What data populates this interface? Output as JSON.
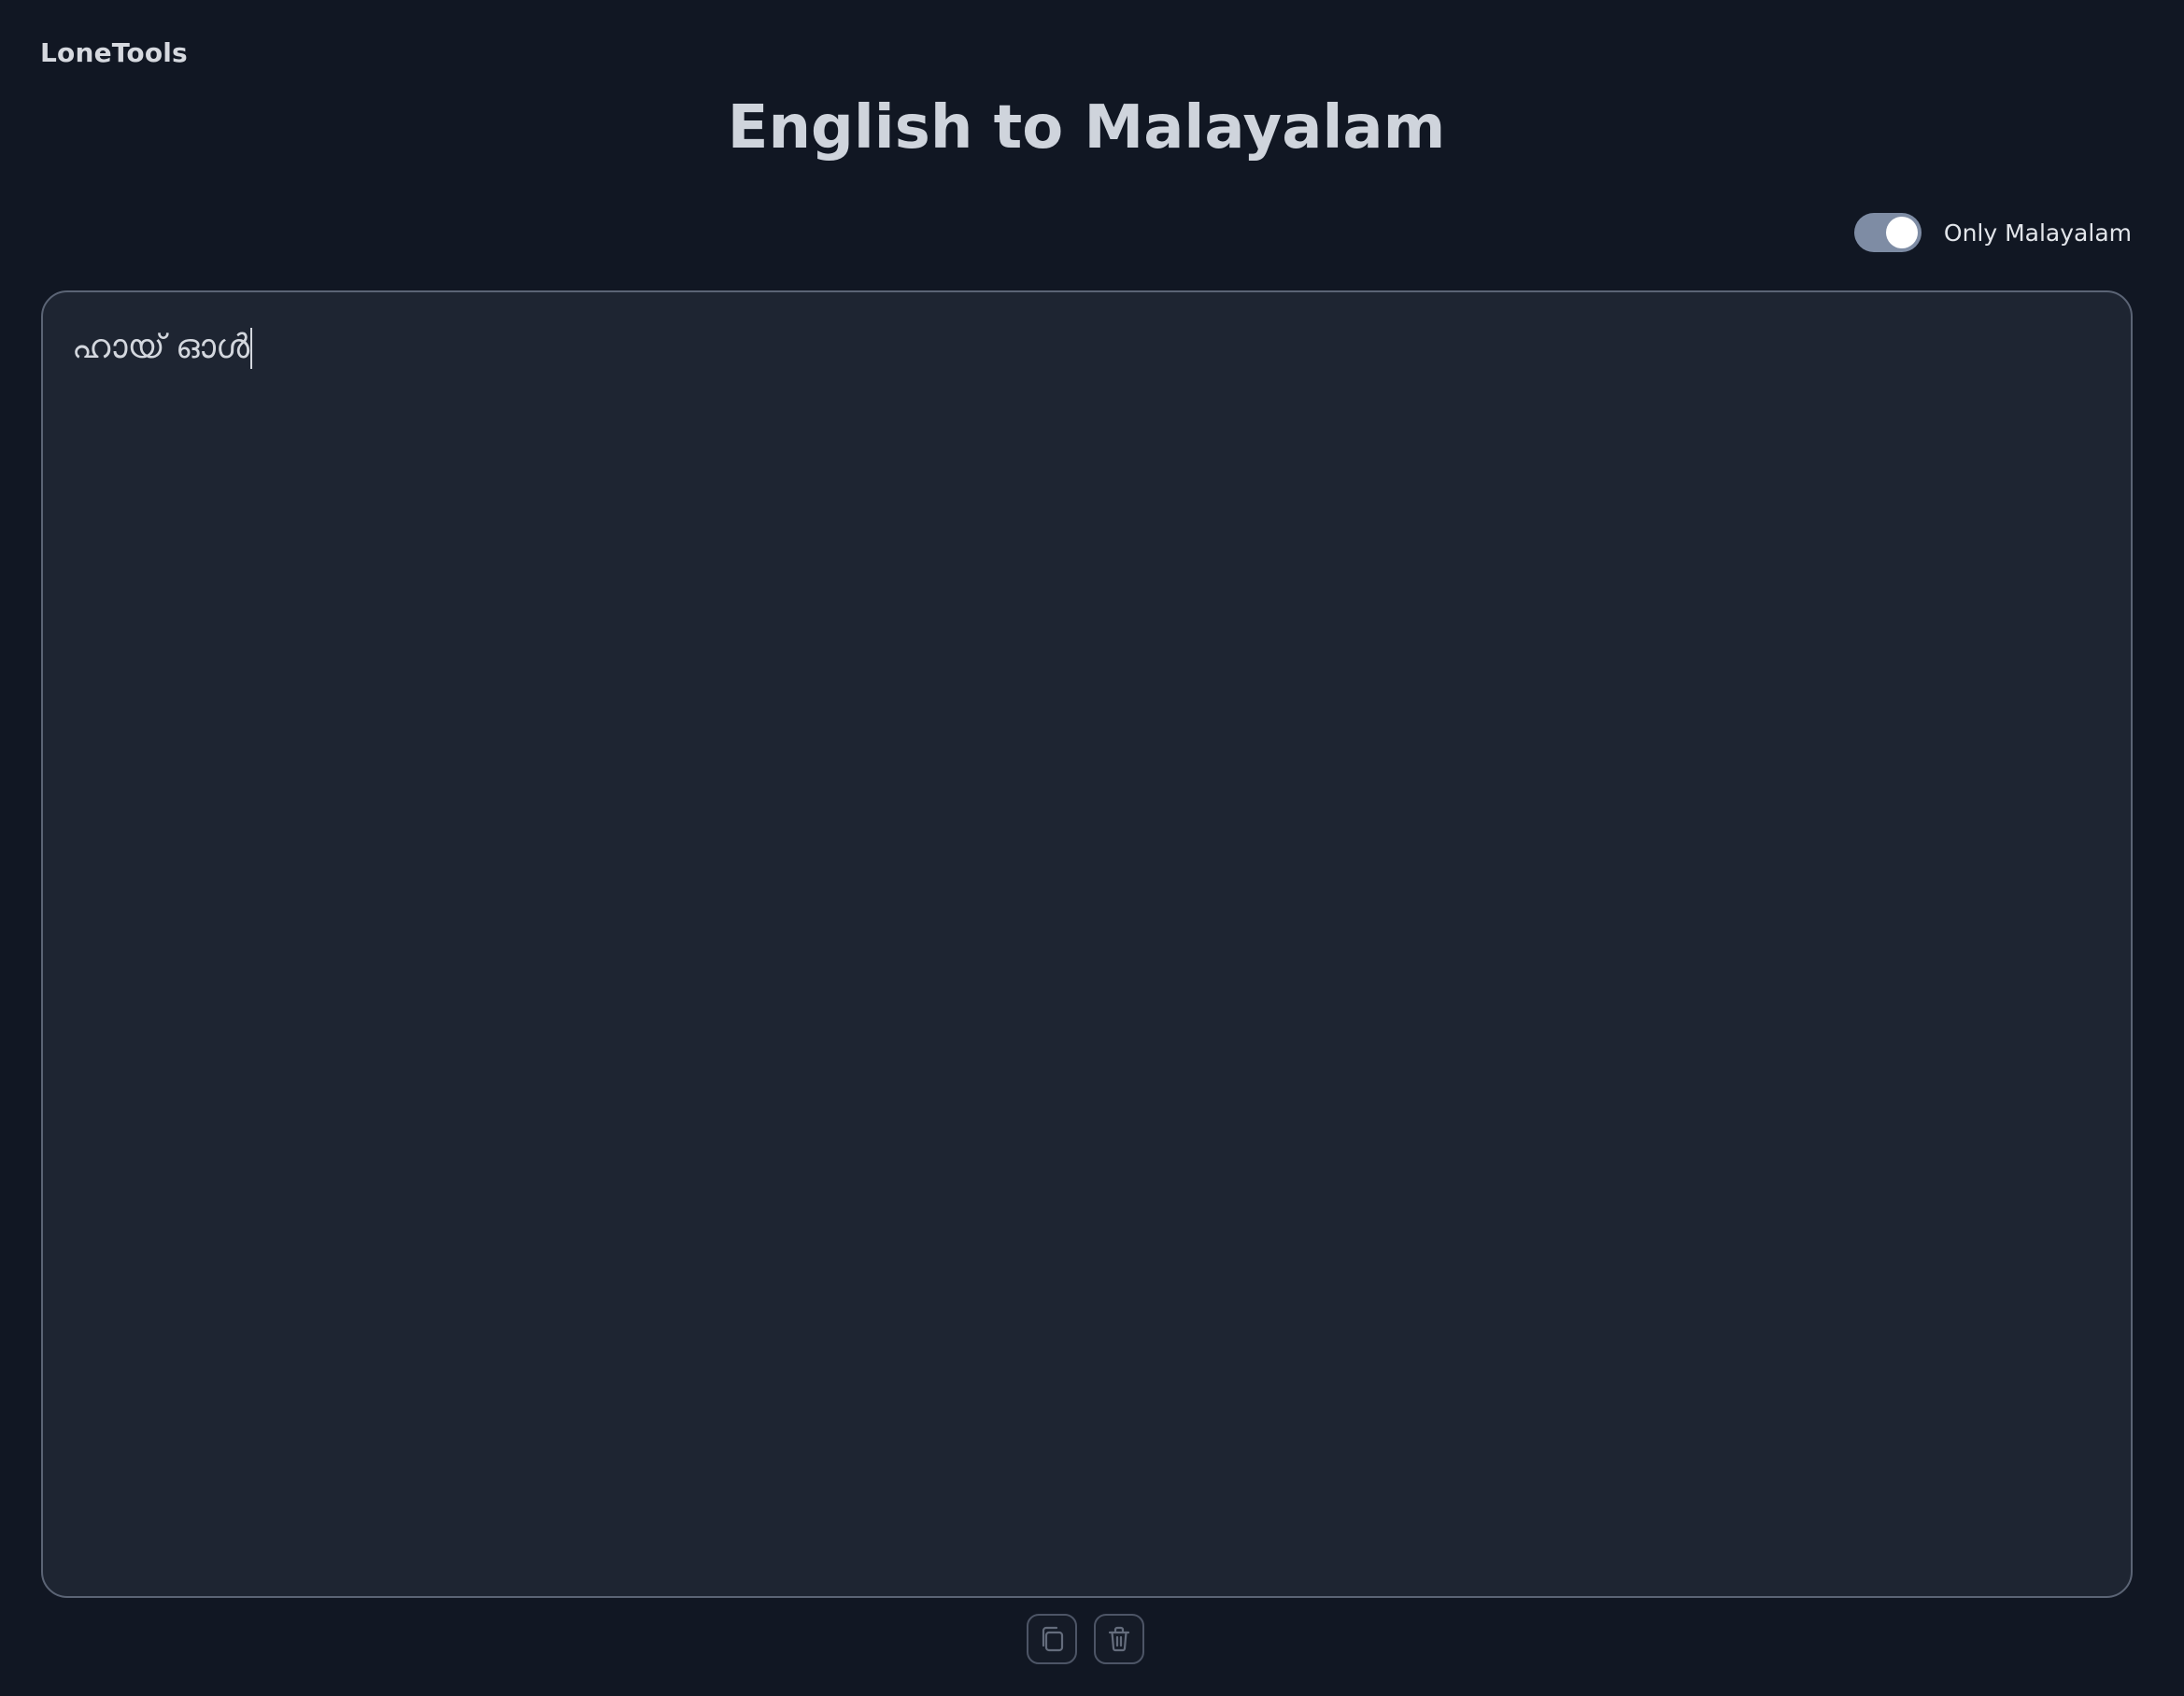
{
  "header": {
    "brand": "LoneTools",
    "title": "English to Malayalam"
  },
  "options": {
    "only_malayalam_label": "Only Malayalam",
    "only_malayalam_enabled": true
  },
  "editor": {
    "text": "ഹായ് ഓൾ"
  },
  "actions": {
    "copy_icon": "copy-icon",
    "delete_icon": "trash-icon"
  },
  "colors": {
    "background": "#111723",
    "editor_background": "#1e2532",
    "toggle_on": "#7e8ca4",
    "text": "#d1d5db"
  }
}
